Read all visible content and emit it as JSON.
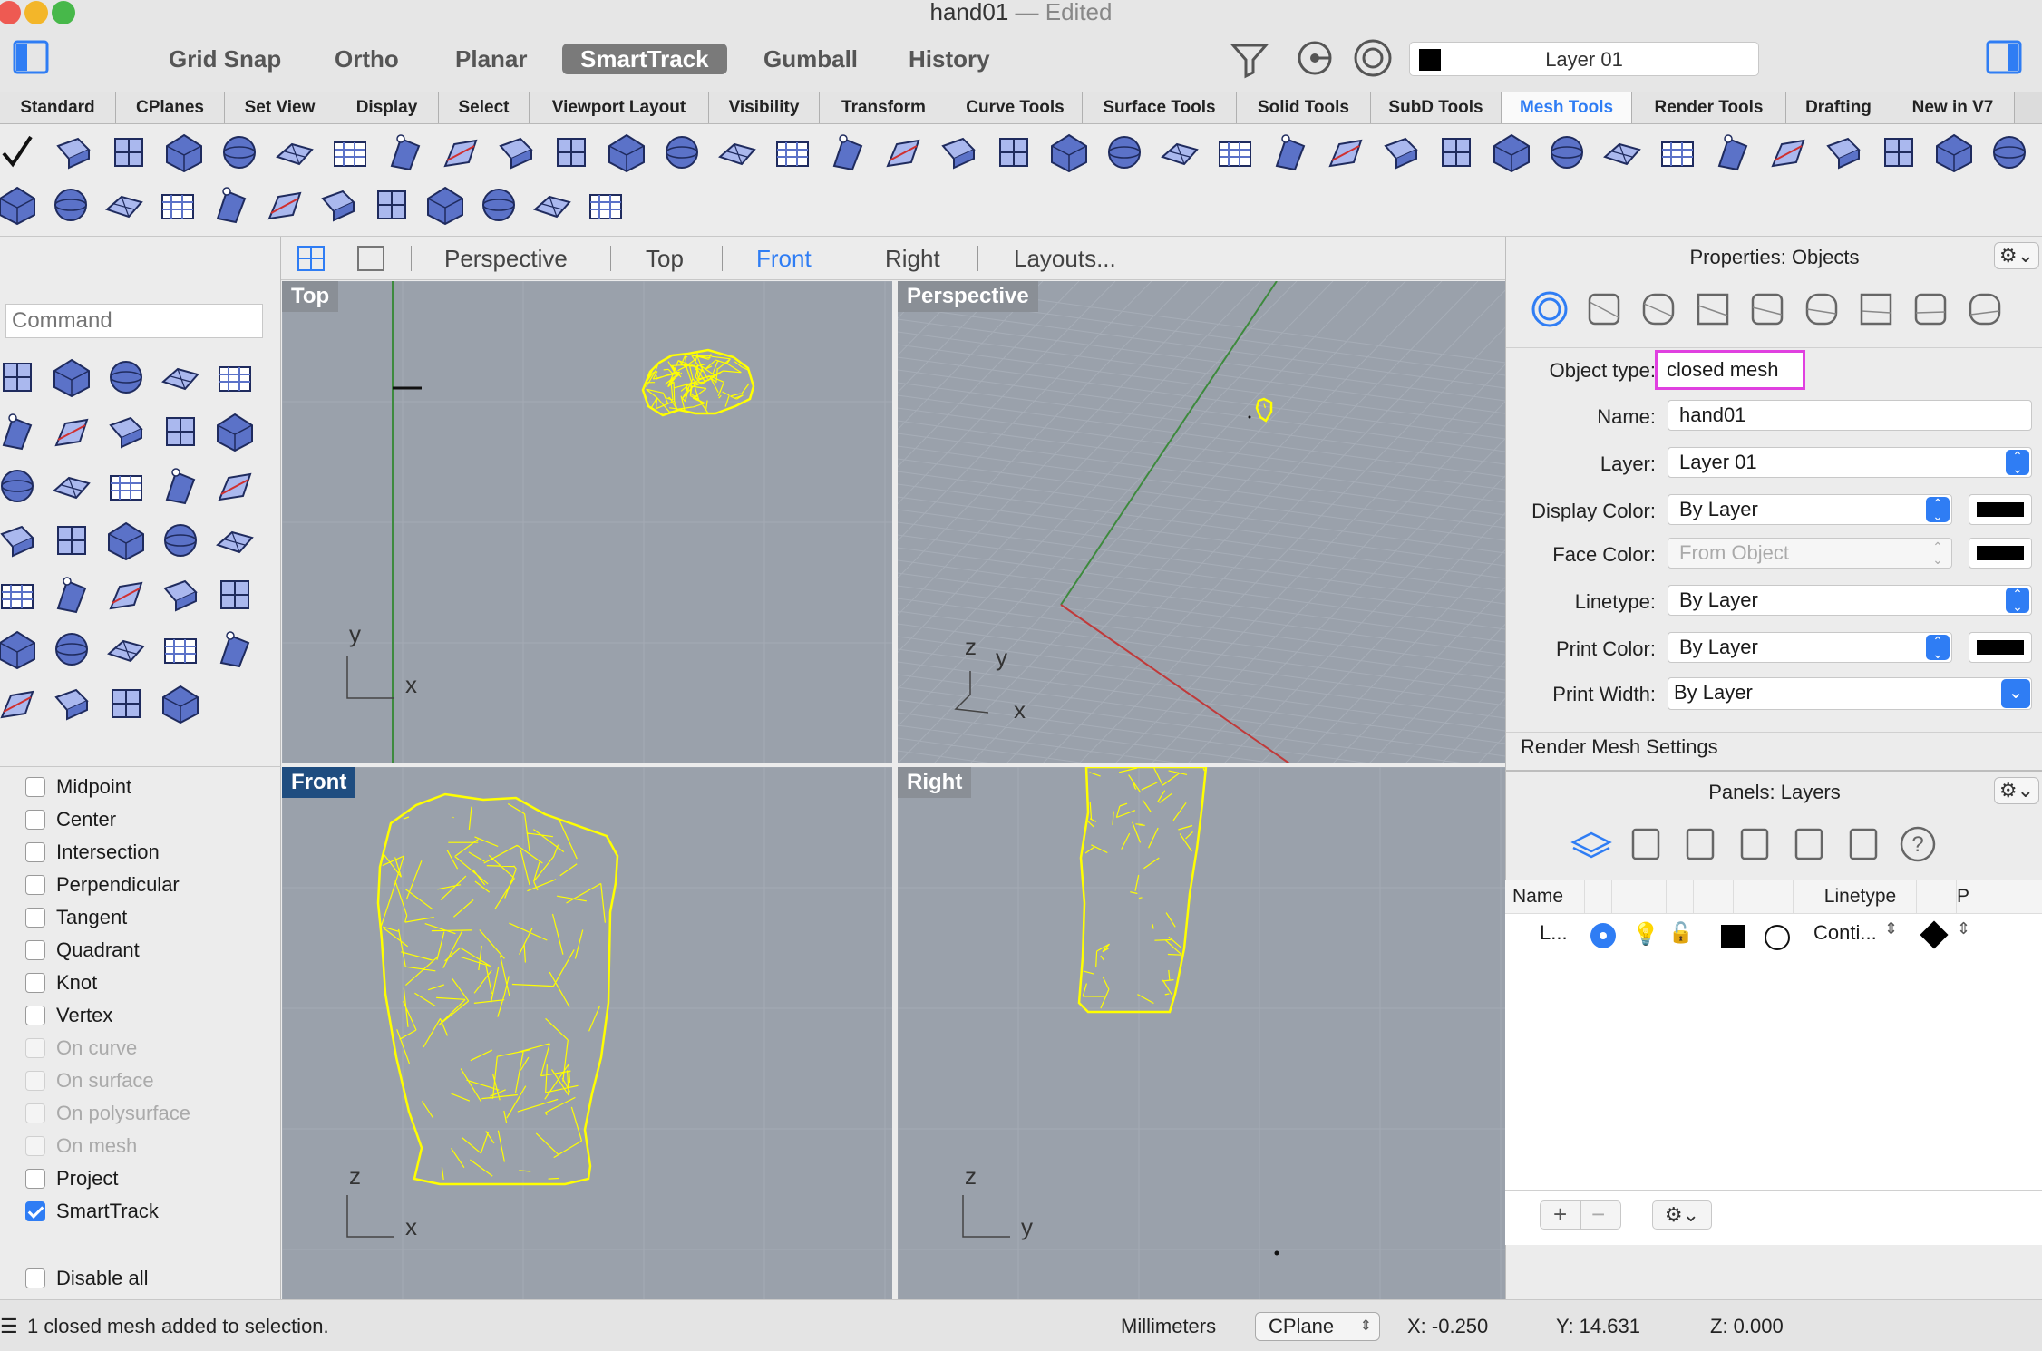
{
  "window": {
    "title": "hand01",
    "edited": "— Edited"
  },
  "toggles": [
    {
      "label": "Grid Snap",
      "on": false
    },
    {
      "label": "Ortho",
      "on": false
    },
    {
      "label": "Planar",
      "on": false
    },
    {
      "label": "SmartTrack",
      "on": true
    },
    {
      "label": "Gumball",
      "on": false
    },
    {
      "label": "History",
      "on": false
    }
  ],
  "current_layer": {
    "label": "Layer 01",
    "color": "#000000"
  },
  "tabs": [
    "Standard",
    "CPlanes",
    "Set View",
    "Display",
    "Select",
    "Viewport Layout",
    "Visibility",
    "Transform",
    "Curve Tools",
    "Surface Tools",
    "Solid Tools",
    "SubD Tools",
    "Mesh Tools",
    "Render Tools",
    "Drafting",
    "New in V7"
  ],
  "active_tab": "Mesh Tools",
  "viewport_tabs": {
    "items": [
      "Perspective",
      "Top",
      "Front",
      "Right",
      "Layouts..."
    ],
    "active": "Front"
  },
  "command": {
    "placeholder": "Command"
  },
  "viewports": {
    "top": {
      "label": "Top",
      "axis_a": "y",
      "axis_b": "x"
    },
    "perspective": {
      "label": "Perspective",
      "axis_a": "z",
      "axis_b": "y",
      "axis_c": "x"
    },
    "front": {
      "label": "Front",
      "axis_a": "z",
      "axis_b": "x"
    },
    "right": {
      "label": "Right",
      "axis_a": "z",
      "axis_b": "y"
    }
  },
  "osnaps": [
    {
      "label": "Midpoint",
      "checked": false,
      "enabled": true
    },
    {
      "label": "Center",
      "checked": false,
      "enabled": true
    },
    {
      "label": "Intersection",
      "checked": false,
      "enabled": true
    },
    {
      "label": "Perpendicular",
      "checked": false,
      "enabled": true
    },
    {
      "label": "Tangent",
      "checked": false,
      "enabled": true
    },
    {
      "label": "Quadrant",
      "checked": false,
      "enabled": true
    },
    {
      "label": "Knot",
      "checked": false,
      "enabled": true
    },
    {
      "label": "Vertex",
      "checked": false,
      "enabled": true
    },
    {
      "label": "On curve",
      "checked": false,
      "enabled": false
    },
    {
      "label": "On surface",
      "checked": false,
      "enabled": false
    },
    {
      "label": "On polysurface",
      "checked": false,
      "enabled": false
    },
    {
      "label": "On mesh",
      "checked": false,
      "enabled": false
    },
    {
      "label": "Project",
      "checked": false,
      "enabled": true
    },
    {
      "label": "SmartTrack",
      "checked": true,
      "enabled": true
    }
  ],
  "disable_all": {
    "label": "Disable all",
    "checked": false
  },
  "properties": {
    "title": "Properties: Objects",
    "object_type_label": "Object type:",
    "object_type": "closed mesh",
    "name_label": "Name:",
    "name": "hand01",
    "layer_label": "Layer:",
    "layer": "Layer 01",
    "display_color_label": "Display Color:",
    "display_color": "By Layer",
    "face_color_label": "Face Color:",
    "face_color": "From Object",
    "linetype_label": "Linetype:",
    "linetype": "By Layer",
    "print_color_label": "Print Color:",
    "print_color": "By Layer",
    "print_width_label": "Print Width:",
    "print_width": "By Layer",
    "render_mesh": "Render Mesh Settings",
    "highlight_color": "#e040e0"
  },
  "layers_panel": {
    "title": "Panels: Layers",
    "columns": {
      "name": "Name",
      "linetype": "Linetype",
      "print": "P"
    },
    "rows": [
      {
        "name": "L...",
        "linetype": "Conti...",
        "color": "#000000"
      }
    ]
  },
  "status": {
    "message": "1 closed mesh added to selection.",
    "units": "Millimeters",
    "cplane": "CPlane",
    "x": "X: -0.250",
    "y": "Y: 14.631",
    "z": "Z: 0.000"
  },
  "colors": {
    "accent": "#2f7df4",
    "mesh": "#ffff00",
    "viewport_bg": "#9aa1ab",
    "active_vp_label": "#1f4d80"
  }
}
